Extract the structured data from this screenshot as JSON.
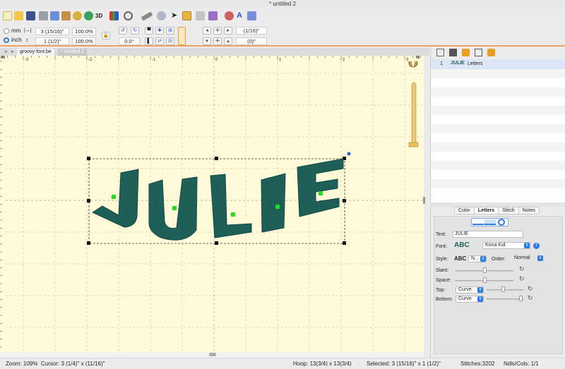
{
  "window": {
    "title": "* untitled 2"
  },
  "toolbar": {
    "icons": [
      "new-file-icon",
      "open-folder-icon",
      "save-icon",
      "print-icon",
      "copy-icon",
      "paste-icon",
      "money-icon",
      "dollar-icon",
      "3d-view-icon",
      "bar-chart-icon",
      "magnifier-icon",
      "ruler-icon",
      "hoop-icon",
      "pointer-icon",
      "folder-icon",
      "split-icon",
      "grid-icon",
      "thread-icon",
      "text-tool-icon",
      "palette-icon"
    ],
    "label_3d": "3D"
  },
  "units": {
    "mm": "mm",
    "inch": "inch",
    "selected": "inch"
  },
  "size": {
    "width": "3 (15/16)\"",
    "width_pct": "100.0%",
    "height": "1 (1/2)\"",
    "height_pct": "100.0%"
  },
  "rotation": {
    "angle": "0.0°"
  },
  "position": {
    "x": "(1/16)\"",
    "y": "(0)\""
  },
  "tabs": [
    {
      "label": "groovy-font.be",
      "active": false
    },
    {
      "label": "* untitled 2",
      "active": true
    }
  ],
  "ruler": {
    "top_labels": [
      "-3",
      "-2",
      "-1",
      "0",
      "1",
      "2",
      "3"
    ],
    "corner": "IN"
  },
  "design": {
    "text": "JULIE",
    "thread_color": "#1e5f58"
  },
  "objects": {
    "rows": [
      {
        "index": "1",
        "thumb": "JULIE",
        "name": "Letters"
      }
    ]
  },
  "prop_tabs": [
    {
      "label": "Color",
      "active": false
    },
    {
      "label": "Letters",
      "active": true
    },
    {
      "label": "Stitch",
      "active": false
    },
    {
      "label": "Notes",
      "active": false
    }
  ],
  "letters": {
    "text_label": "Text:",
    "text_value": "JULIE",
    "font_label": "Font:",
    "font_preview": "ABC",
    "font_name": "Kona Kid",
    "style_label": "Style:",
    "style_preview": "ABC",
    "style_value": "N...",
    "order_label": "Order:",
    "order_value": "Normal",
    "slant_label": "Slant:",
    "slant_value": 0.5,
    "space_label": "Space:",
    "space_value": 0.5,
    "top_label": "Top:",
    "top_value": "Curve",
    "top_level": 0.45,
    "bottom_label": "Bottom:",
    "bottom_value": "Curve",
    "bottom_level": 0.93
  },
  "status": {
    "zoom": "Zoom: 109%",
    "cursor": "Cursor: 3 (1/4)\" x (11/16)\"",
    "hoop": "Hoop: 13(3/4) x 13(3/4)",
    "selected": "Selected: 3 (15/16)\" x 1 (1/2)\"",
    "stitches": "Stitches:3202",
    "ndls": "Ndls/Cols: 1/1"
  },
  "colors": {
    "accent": "#2b7be4",
    "canvas": "#fffbd8",
    "orange_rule": "#f0a060",
    "handle_green": "#22dd22"
  }
}
